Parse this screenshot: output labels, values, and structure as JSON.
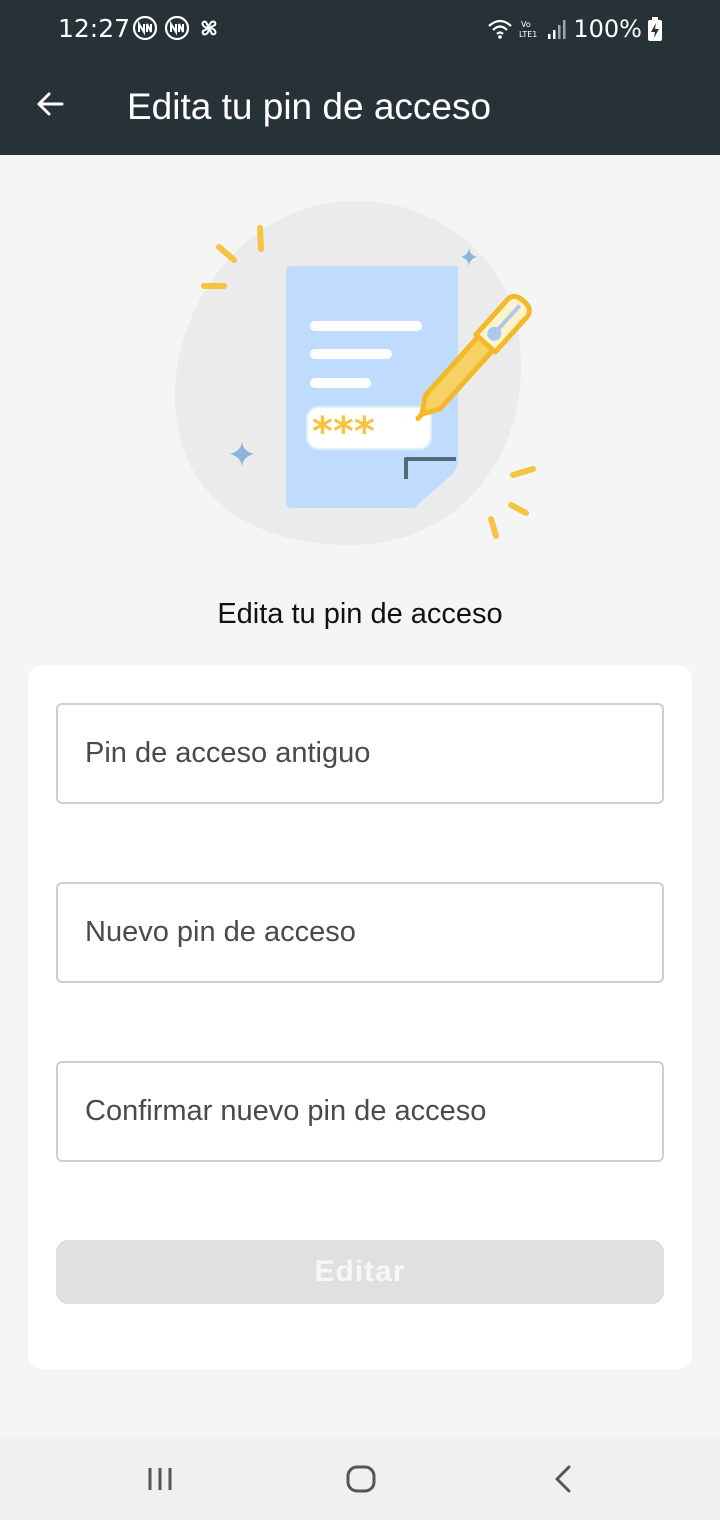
{
  "status_bar": {
    "time": "12:27",
    "battery_text": "100%",
    "left_icons": [
      "ni-badge-icon",
      "ni-badge-icon",
      "pinwheel-icon"
    ],
    "right_icons": [
      "wifi-icon",
      "volte-icon",
      "signal-icon",
      "battery-charging-icon"
    ]
  },
  "app_bar": {
    "back_icon": "arrow-left-icon",
    "title": "Edita tu pin de acceso"
  },
  "main": {
    "illustration_stars": "***",
    "section_title": "Edita tu pin de acceso",
    "fields": [
      {
        "placeholder": "Pin de acceso antiguo"
      },
      {
        "placeholder": "Nuevo pin de acceso"
      },
      {
        "placeholder": "Confirmar nuevo pin de acceso"
      }
    ],
    "submit_label": "Editar"
  },
  "colors": {
    "app_bar": "#263238",
    "background": "#f5f5f5",
    "card": "#ffffff",
    "accent_yellow": "#f6c342",
    "document_blue": "#bfdcff",
    "button_disabled": "#e0e0e0"
  },
  "nav_bar": {
    "recents_icon": "recents-icon",
    "home_icon": "home-icon",
    "back_icon": "back-chevron-icon"
  }
}
